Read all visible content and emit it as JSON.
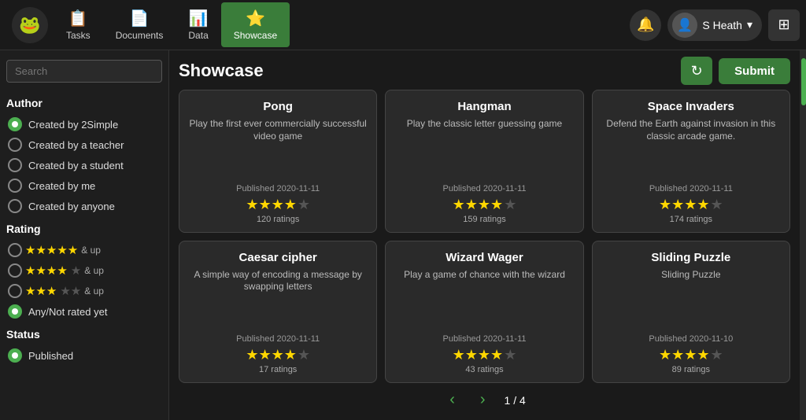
{
  "app": {
    "title": "Showcase"
  },
  "topnav": {
    "logo_icon": "🐸",
    "items": [
      {
        "id": "tasks",
        "label": "Tasks",
        "icon": "📋",
        "active": false
      },
      {
        "id": "documents",
        "label": "Documents",
        "icon": "📄",
        "active": false
      },
      {
        "id": "data",
        "label": "Data",
        "icon": "📊",
        "active": false
      },
      {
        "id": "showcase",
        "label": "Showcase",
        "icon": "⭐",
        "active": true
      }
    ],
    "notifications_icon": "🔔",
    "user_name": "S Heath",
    "user_icon": "👤",
    "grid_icon": "⊞"
  },
  "sidebar": {
    "search_placeholder": "Search",
    "sections": {
      "author": {
        "title": "Author",
        "filters": [
          {
            "id": "by-2simple",
            "label": "Created by 2Simple",
            "checked": true
          },
          {
            "id": "by-teacher",
            "label": "Created by a teacher",
            "checked": false
          },
          {
            "id": "by-student",
            "label": "Created by a student",
            "checked": false
          },
          {
            "id": "by-me",
            "label": "Created by me",
            "checked": false
          },
          {
            "id": "by-anyone",
            "label": "Created by anyone",
            "checked": false
          }
        ]
      },
      "rating": {
        "title": "Rating",
        "options": [
          {
            "id": "5star",
            "stars": 5,
            "empty": 0,
            "label": "& up"
          },
          {
            "id": "4star",
            "stars": 4,
            "empty": 1,
            "label": "& up"
          },
          {
            "id": "3star",
            "stars": 3,
            "empty": 2,
            "label": "& up"
          }
        ],
        "any_label": "Any/Not rated yet",
        "any_checked": true
      },
      "status": {
        "title": "Status",
        "options": [
          {
            "id": "published",
            "label": "Published",
            "checked": true
          }
        ]
      }
    }
  },
  "header": {
    "title": "Showcase",
    "refresh_label": "↻",
    "submit_label": "Submit"
  },
  "cards": [
    {
      "id": "pong",
      "title": "Pong",
      "description": "Play the first ever commercially successful video game",
      "published": "Published 2020-11-11",
      "stars": 4,
      "total_stars": 5,
      "ratings": "120 ratings"
    },
    {
      "id": "hangman",
      "title": "Hangman",
      "description": "Play the classic letter guessing game",
      "published": "Published 2020-11-11",
      "stars": 4,
      "total_stars": 5,
      "ratings": "159 ratings"
    },
    {
      "id": "space-invaders",
      "title": "Space Invaders",
      "description": "Defend the Earth against invasion in this classic arcade game.",
      "published": "Published 2020-11-11",
      "stars": 4,
      "total_stars": 5,
      "ratings": "174 ratings"
    },
    {
      "id": "caesar-cipher",
      "title": "Caesar cipher",
      "description": "A simple way of encoding a message by swapping letters",
      "published": "Published 2020-11-11",
      "stars": 4,
      "total_stars": 5,
      "ratings": "17 ratings"
    },
    {
      "id": "wizard-wager",
      "title": "Wizard Wager",
      "description": "Play a game of chance with the wizard",
      "published": "Published 2020-11-11",
      "stars": 4,
      "total_stars": 5,
      "ratings": "43 ratings"
    },
    {
      "id": "sliding-puzzle",
      "title": "Sliding Puzzle",
      "description": "Sliding Puzzle",
      "published": "Published 2020-11-10",
      "stars": 4,
      "total_stars": 5,
      "ratings": "89 ratings"
    }
  ],
  "pagination": {
    "current": "1",
    "total": "4",
    "separator": "/",
    "prev_label": "‹",
    "next_label": "›"
  }
}
